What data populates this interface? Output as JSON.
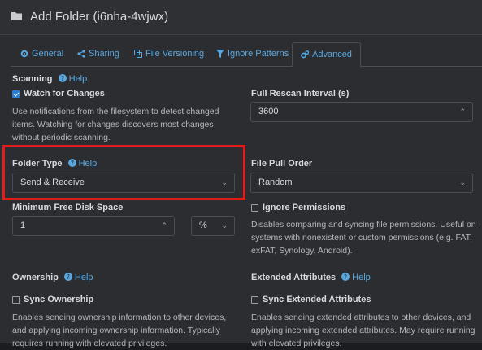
{
  "header": {
    "title": "Add Folder (i6nha-4wjwx)"
  },
  "tabs": [
    {
      "label": "General"
    },
    {
      "label": "Sharing"
    },
    {
      "label": "File Versioning"
    },
    {
      "label": "Ignore Patterns"
    },
    {
      "label": "Advanced"
    }
  ],
  "help_label": "Help",
  "scanning": {
    "label": "Scanning",
    "watch_label": "Watch for Changes",
    "watch_desc": "Use notifications from the filesystem to detect changed items. Watching for changes discovers most changes without periodic scanning."
  },
  "rescan": {
    "label": "Full Rescan Interval (s)",
    "value": "3600"
  },
  "folder_type": {
    "label": "Folder Type",
    "value": "Send & Receive"
  },
  "pull_order": {
    "label": "File Pull Order",
    "value": "Random"
  },
  "min_disk": {
    "label": "Minimum Free Disk Space",
    "value": "1",
    "unit": "%"
  },
  "ignore_perms": {
    "label": "Ignore Permissions",
    "desc": "Disables comparing and syncing file permissions. Useful on systems with nonexistent or custom permissions (e.g. FAT, exFAT, Synology, Android)."
  },
  "ownership": {
    "label": "Ownership",
    "sync_label": "Sync Ownership",
    "desc": "Enables sending ownership information to other devices, and applying incoming ownership information. Typically requires running with elevated privileges."
  },
  "xattrs": {
    "label": "Extended Attributes",
    "sync_label": "Sync Extended Attributes",
    "desc": "Enables sending extended attributes to other devices, and applying incoming extended attributes. May require running with elevated privileges."
  },
  "colors": {
    "accent": "#5aa8e0",
    "highlight": "#e21b1b",
    "checkbox": "#2a7fd6"
  }
}
